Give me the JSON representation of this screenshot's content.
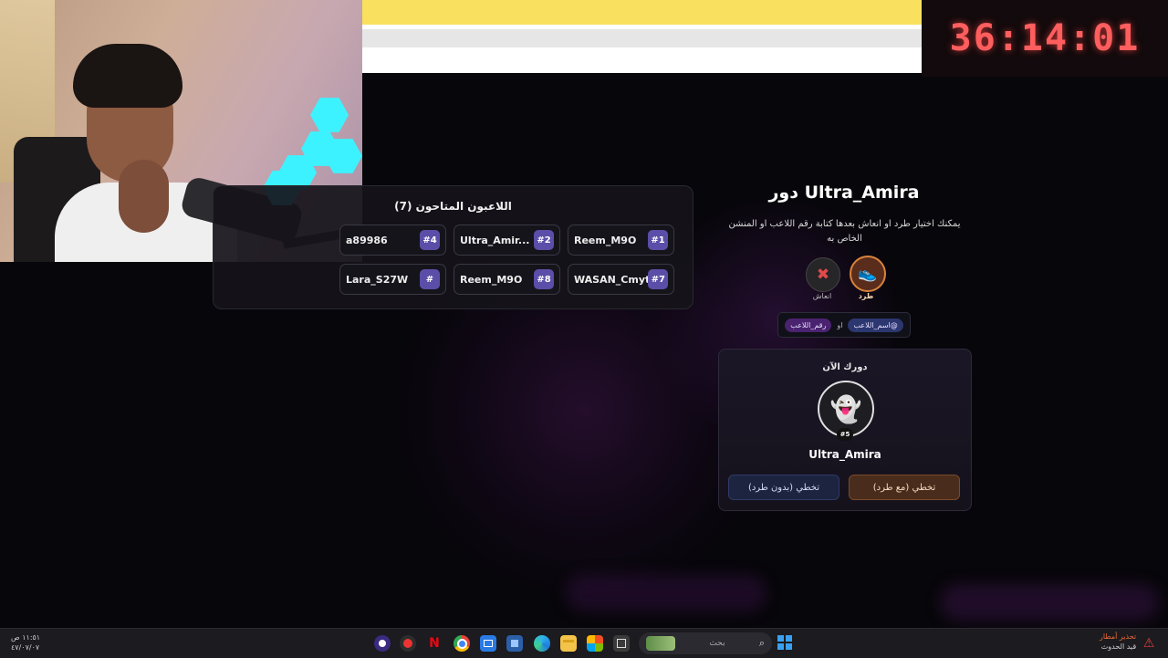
{
  "timer": "36:14:01",
  "players_panel": {
    "title": "اللاعبون المتاحون (7)",
    "players": [
      {
        "num": "#1",
        "name": "Reem_M9O"
      },
      {
        "num": "#2",
        "name": "Ultra_Amir..."
      },
      {
        "num": "#4",
        "name": "a89986"
      },
      {
        "num": "#7",
        "name": "WASAN_Cmyt"
      },
      {
        "num": "#8",
        "name": "Reem_M9O"
      },
      {
        "num": "#",
        "name": "Lara_S27W"
      }
    ]
  },
  "turn": {
    "title": "دور Ultra_Amira",
    "description": "يمكنك اختيار طرد او انعاش بعدها كتابة رقم اللاعب او المنشن الخاص به",
    "actions": [
      {
        "label": "طرد",
        "icon": "kick-shoe-icon"
      },
      {
        "label": "انعاش",
        "icon": "revive-syringe-icon"
      }
    ],
    "mention_name": "@اسم_اللاعب",
    "or": "او",
    "mention_number": "رقم_اللاعب"
  },
  "now_panel": {
    "title": "دورك الآن",
    "avatar_badge": "#5",
    "player_name": "Ultra_Amira",
    "btn_skip_kick": "تخطي (مع طرد)",
    "btn_skip_no_kick": "تخطي (بدون طرد)"
  },
  "taskbar": {
    "search_placeholder": "بحث",
    "clock_time": "١١:٥١ ص",
    "clock_date": "٤٧/٠٧/٠٧",
    "weather_title": "تحذير أمطار",
    "weather_sub": "قيد الحدوث",
    "icons": [
      "windows-start-icon",
      "search-icon",
      "explorer-icon",
      "store-icon",
      "folder-icon",
      "edge-icon",
      "settings-icon",
      "outlook-icon",
      "chrome-icon",
      "netflix-icon",
      "app-icon",
      "obs-icon"
    ]
  },
  "colors": {
    "timer": "#ff5e5e",
    "accent_purple": "#5a4ea8",
    "kick_orange": "#d8843c"
  }
}
